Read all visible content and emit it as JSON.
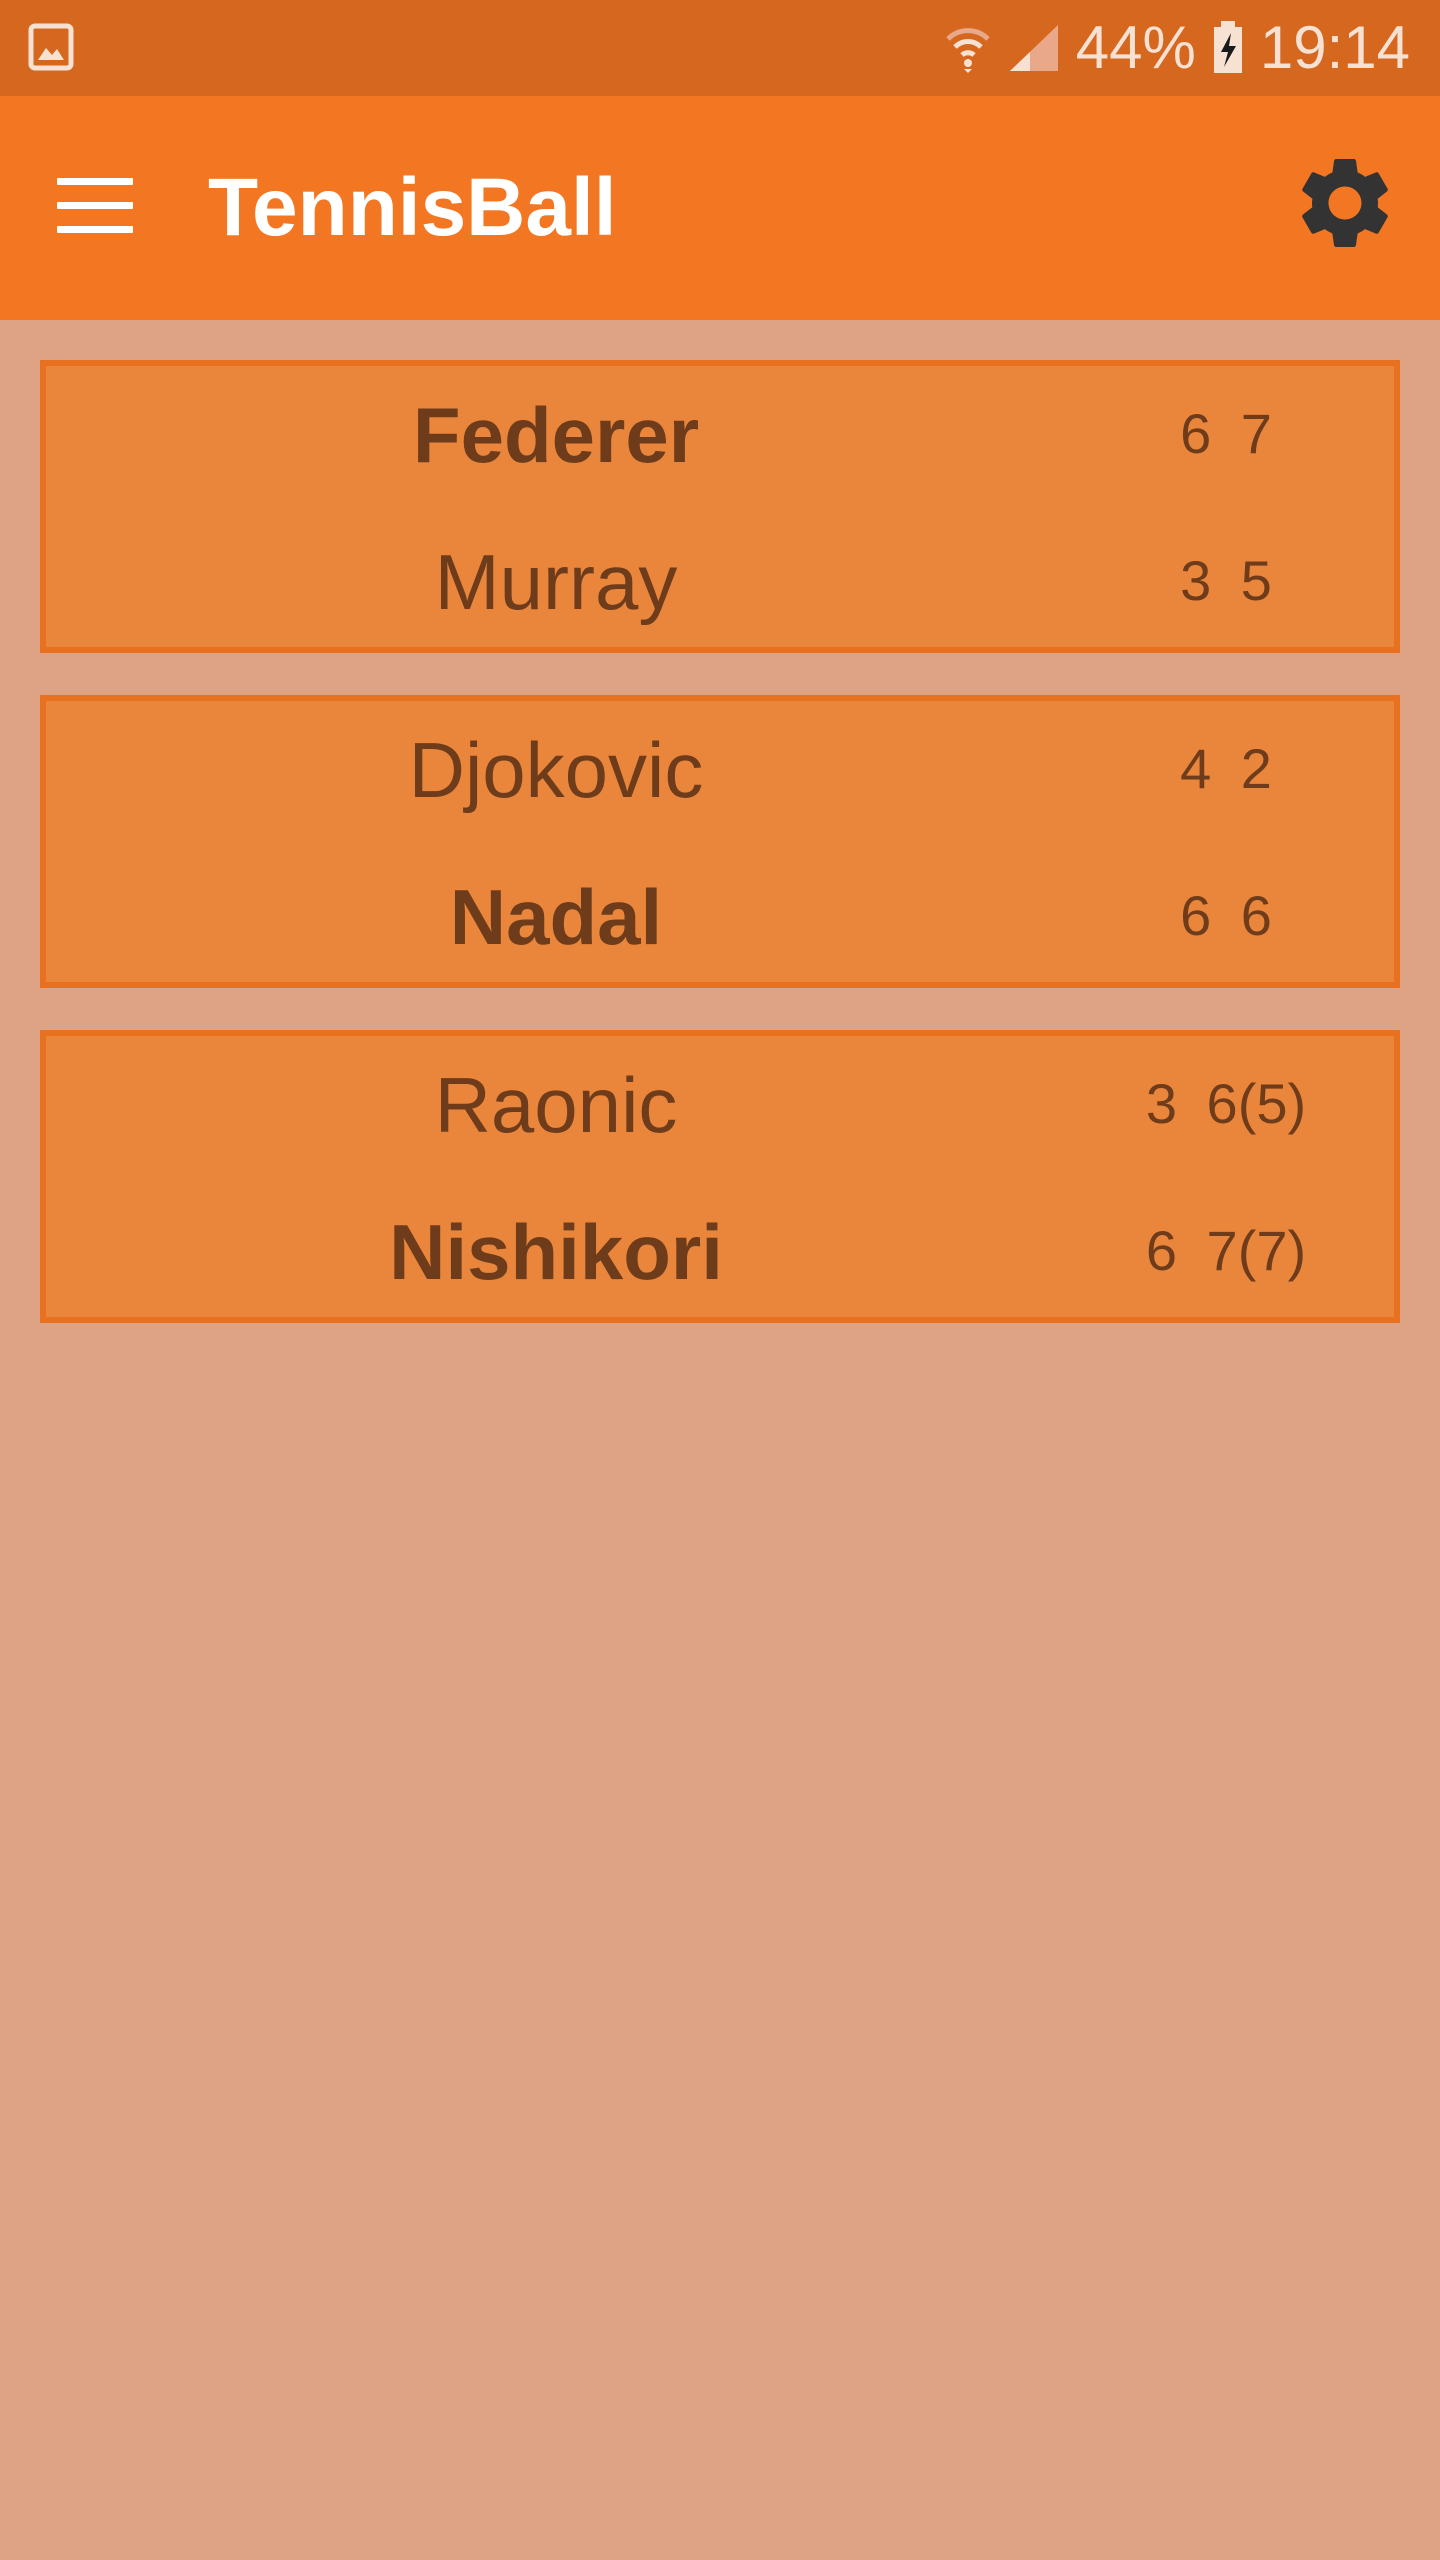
{
  "status_bar": {
    "left_icon": "image-icon",
    "wifi_icon": "wifi-icon",
    "signal_icon": "signal-icon",
    "battery_percent": "44%",
    "battery_icon": "battery-charging-icon",
    "time": "19:14"
  },
  "app_bar": {
    "menu_icon": "hamburger-menu-icon",
    "title": "TennisBall",
    "settings_icon": "gear-icon"
  },
  "matches": [
    {
      "player1": {
        "name": "Federer",
        "scores": "6 7",
        "winner": true
      },
      "player2": {
        "name": "Murray",
        "scores": "3 5",
        "winner": false
      }
    },
    {
      "player1": {
        "name": "Djokovic",
        "scores": "4 2",
        "winner": false
      },
      "player2": {
        "name": "Nadal",
        "scores": "6 6",
        "winner": true
      }
    },
    {
      "player1": {
        "name": "Raonic",
        "scores": "3 6(5)",
        "winner": false
      },
      "player2": {
        "name": "Nishikori",
        "scores": "6 7(7)",
        "winner": true
      }
    }
  ],
  "colors": {
    "status_bar": "#d5681e",
    "app_bar": "#f37722",
    "background": "#dea285",
    "card": "#ea863c",
    "card_border": "#e8711f",
    "text": "#6e3c1a"
  }
}
